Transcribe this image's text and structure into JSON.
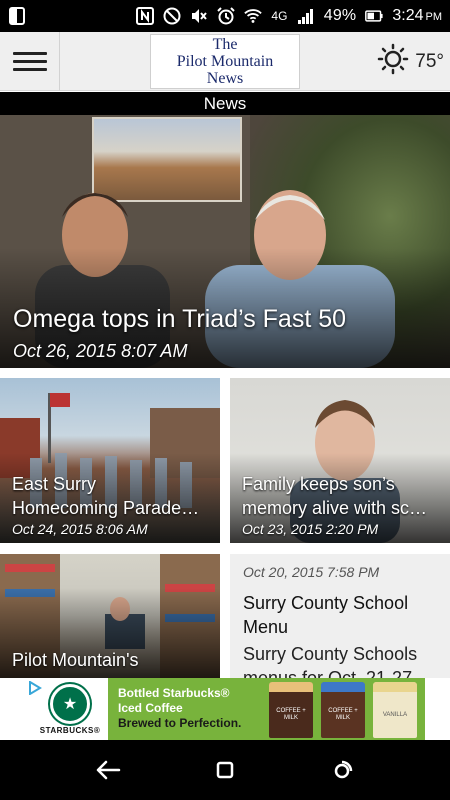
{
  "status_bar": {
    "battery": "49%",
    "time": "3:24",
    "ampm": "PM",
    "network": "4G",
    "icons": [
      "screenshot-icon",
      "nfc-icon",
      "do-not-disturb-icon",
      "mute-icon",
      "alarm-icon",
      "wifi-icon",
      "signal-icon",
      "battery-icon"
    ]
  },
  "app_bar": {
    "logo_line1": "The",
    "logo_line2": "Pilot Mountain",
    "logo_line3": "News",
    "temperature": "75°",
    "weather_icon": "sun-icon"
  },
  "section": {
    "title": "News"
  },
  "hero": {
    "title": "Omega tops in Triad’s Fast 50",
    "date": "Oct 26, 2015 8:07 AM"
  },
  "cards": [
    {
      "title_line1": "East Surry",
      "title_line2": "Homecoming Parade…",
      "date": "Oct 24, 2015 8:06 AM"
    },
    {
      "title_line1": "Family keeps son’s",
      "title_line2": "memory alive with sc…",
      "date": "Oct 23, 2015 2:20 PM"
    },
    {
      "title_line1": "Pilot Mountain's"
    },
    {
      "date": "Oct 20, 2015 7:58 PM",
      "title": "Surry County School Menu",
      "summary": "Surry County Schools menus for Oct. 21-27"
    }
  ],
  "ad": {
    "brand": "STARBUCKS®",
    "headline_line1": "Bottled Starbucks®",
    "headline_line2": "Iced Coffee",
    "tagline": "Brewed to Perfection.",
    "bottle1": "COFFEE + MILK",
    "bottle2": "COFFEE + MILK",
    "bottle3": "VANILLA",
    "colors": {
      "green": "#78b33c",
      "starbucks_green": "#00704a"
    }
  },
  "nav_bar": {
    "icons": [
      "back-icon",
      "home-icon",
      "recents-icon"
    ]
  }
}
